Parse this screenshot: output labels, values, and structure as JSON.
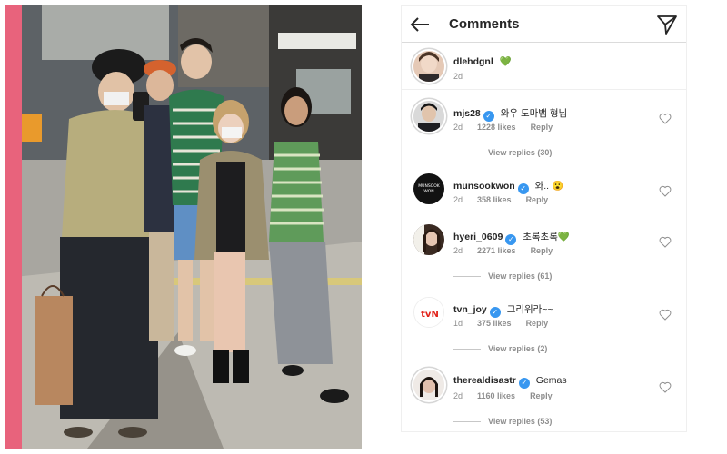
{
  "header": {
    "title": "Comments"
  },
  "caption": {
    "username": "dlehdgnl",
    "text": "💚",
    "time": "2d"
  },
  "comments": [
    {
      "username": "mjs28",
      "verified": true,
      "text": "와우 도마뱀 형님",
      "time": "2d",
      "likes": "1228 likes",
      "reply": "Reply",
      "view_replies": "View replies (30)"
    },
    {
      "username": "munsookwon",
      "verified": true,
      "text": "와.. 😮",
      "time": "2d",
      "likes": "358 likes",
      "reply": "Reply",
      "view_replies": ""
    },
    {
      "username": "hyeri_0609",
      "verified": true,
      "text": "초록초록💚",
      "time": "2d",
      "likes": "2271 likes",
      "reply": "Reply",
      "view_replies": "View replies (61)"
    },
    {
      "username": "tvn_joy",
      "verified": true,
      "text": "그리워라~~",
      "time": "1d",
      "likes": "375 likes",
      "reply": "Reply",
      "view_replies": "View replies (2)"
    },
    {
      "username": "therealdisastr",
      "verified": true,
      "text": "Gemas",
      "time": "2d",
      "likes": "1160 likes",
      "reply": "Reply",
      "view_replies": "View replies (53)"
    }
  ],
  "avatars": {
    "tvn_logo_text": "tvN"
  },
  "colors": {
    "accent_blue": "#3897f0",
    "text_dark": "#262626",
    "text_gray": "#8e8e8e",
    "photo_pink_frame": "#e8637c"
  }
}
